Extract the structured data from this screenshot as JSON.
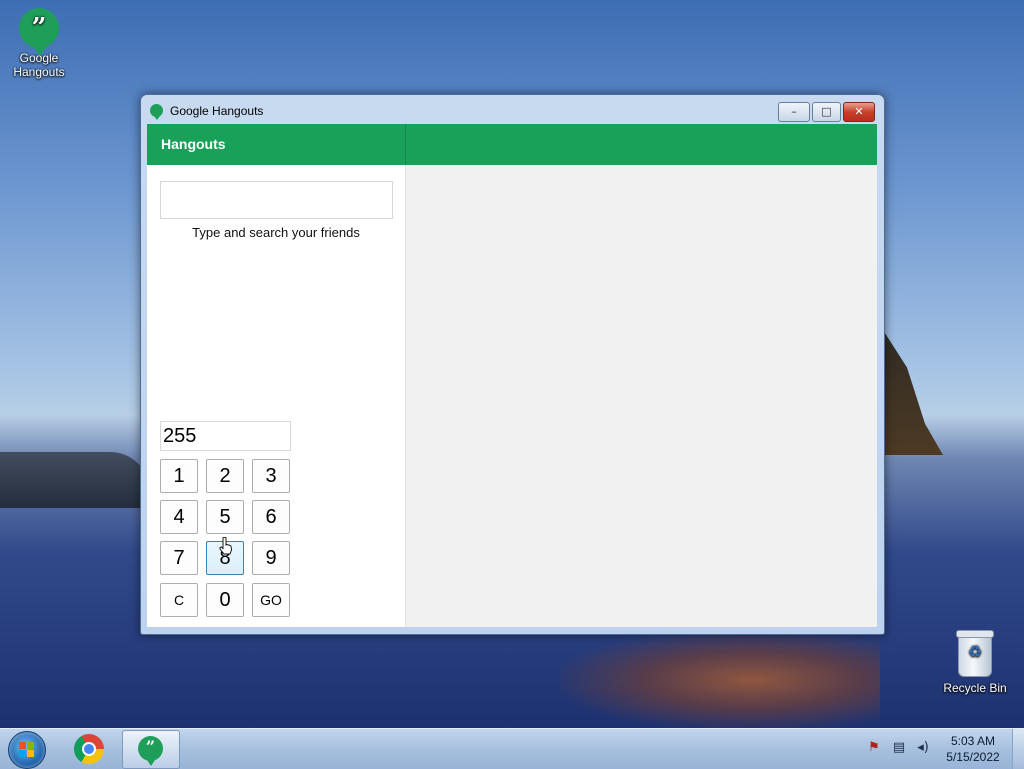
{
  "desktop": {
    "icons": [
      {
        "label": "Google Hangouts",
        "glyph": "”"
      },
      {
        "label": "Recycle Bin",
        "glyph": "♻"
      }
    ]
  },
  "window": {
    "title": "Google Hangouts",
    "controls": {
      "minimize": "–",
      "maximize": "□",
      "close": "✕"
    }
  },
  "app": {
    "header_title": "Hangouts",
    "accent_color": "#19a15a",
    "search": {
      "value": "",
      "hint": "Type and search your friends"
    }
  },
  "keypad": {
    "display": "255",
    "keys": [
      "1",
      "2",
      "3",
      "4",
      "5",
      "6",
      "7",
      "8",
      "9",
      "C",
      "0",
      "GO"
    ],
    "pressed_key": "8"
  },
  "taskbar": {
    "apps": [
      {
        "name": "start",
        "icon": "windows-logo-icon"
      },
      {
        "name": "chrome",
        "icon": "chrome-icon"
      },
      {
        "name": "hangouts",
        "icon": "hangouts-icon",
        "glyph": "”"
      }
    ],
    "tray": {
      "flag": "⚑",
      "network": "▤",
      "volume": "◂)"
    },
    "clock": {
      "time": "5:03 AM",
      "date": "5/15/2022"
    }
  }
}
